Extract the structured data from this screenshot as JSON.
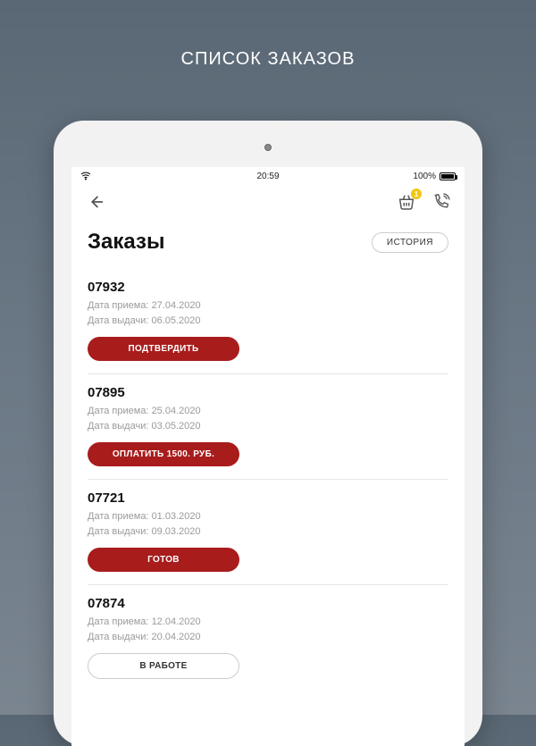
{
  "page_header": "СПИСОК ЗАКАЗОВ",
  "statusbar": {
    "time": "20:59",
    "battery_pct": "100%"
  },
  "topbar": {
    "basket_badge": "1"
  },
  "header": {
    "title": "Заказы",
    "history_btn": "ИСТОРИЯ"
  },
  "labels": {
    "receive": "Дата приема:",
    "issue": "Дата выдачи:"
  },
  "orders": [
    {
      "num": "07932",
      "receive": "27.04.2020",
      "issue": "06.05.2020",
      "action": "ПОДТВЕРДИТЬ",
      "style": "red"
    },
    {
      "num": "07895",
      "receive": "25.04.2020",
      "issue": "03.05.2020",
      "action": "ОПЛАТИТЬ 1500. РУБ.",
      "style": "red"
    },
    {
      "num": "07721",
      "receive": "01.03.2020",
      "issue": "09.03.2020",
      "action": "ГОТОВ",
      "style": "red"
    },
    {
      "num": "07874",
      "receive": "12.04.2020",
      "issue": "20.04.2020",
      "action": "В РАБОТЕ",
      "style": "outline"
    }
  ]
}
